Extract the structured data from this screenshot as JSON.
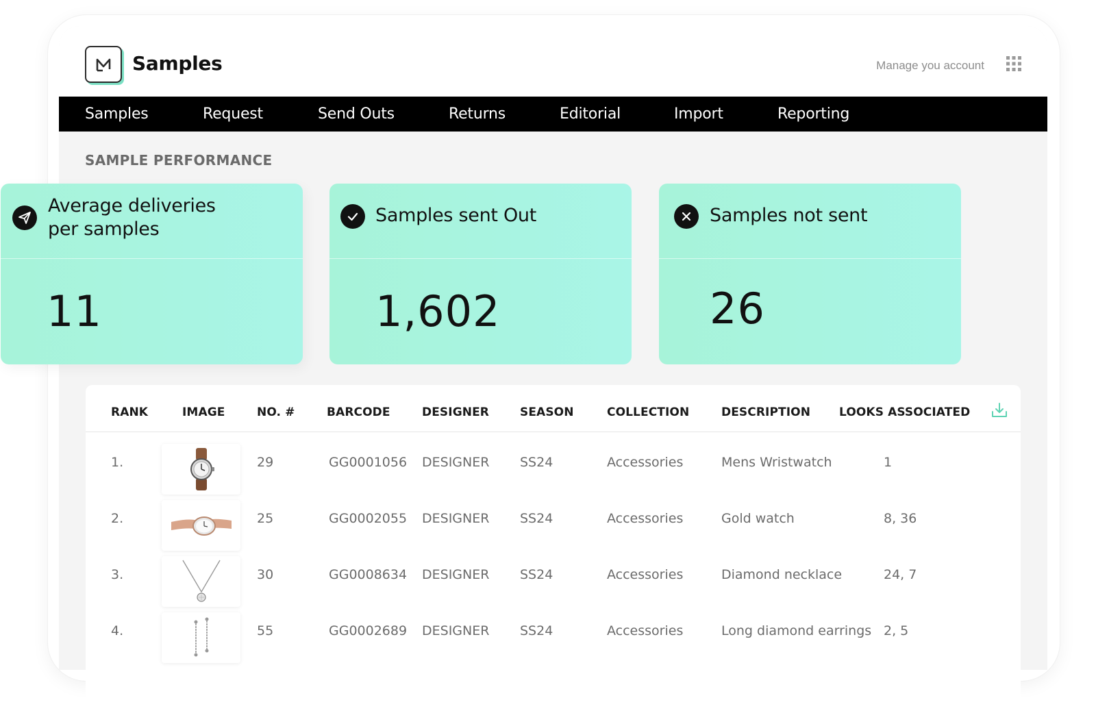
{
  "app": {
    "title": "Samples",
    "manage_account": "Manage you account"
  },
  "nav": [
    {
      "label": "Samples"
    },
    {
      "label": "Request"
    },
    {
      "label": "Send Outs"
    },
    {
      "label": "Returns"
    },
    {
      "label": "Editorial"
    },
    {
      "label": "Import"
    },
    {
      "label": "Reporting"
    }
  ],
  "section": {
    "title": "SAMPLE PERFORMANCE"
  },
  "cards": [
    {
      "label_line1": "Average deliveries",
      "label_line2": "per samples",
      "value": "11",
      "icon": "send-icon"
    },
    {
      "label": "Samples sent Out",
      "value": "1,602",
      "icon": "check-circle-icon"
    },
    {
      "label": "Samples not sent",
      "value": "26",
      "icon": "close-circle-icon"
    }
  ],
  "table": {
    "headers": [
      "RANK",
      "IMAGE",
      "NO. #",
      "BARCODE",
      "DESIGNER",
      "SEASON",
      "COLLECTION",
      "DESCRIPTION",
      "LOOKS ASSOCIATED"
    ],
    "rows": [
      {
        "rank": "1.",
        "image": "watch-leather",
        "no": "29",
        "barcode": "GG0001056",
        "designer": "DESIGNER",
        "season": "SS24",
        "collection": "Accessories",
        "description": "Mens Wristwatch",
        "looks": "1"
      },
      {
        "rank": "2.",
        "image": "watch-gold",
        "no": "25",
        "barcode": "GG0002055",
        "designer": "DESIGNER",
        "season": "SS24",
        "collection": "Accessories",
        "description": "Gold watch",
        "looks": "8, 36"
      },
      {
        "rank": "3.",
        "image": "necklace",
        "no": "30",
        "barcode": "GG0008634",
        "designer": "DESIGNER",
        "season": "SS24",
        "collection": "Accessories",
        "description": "Diamond necklace",
        "looks": "24, 7"
      },
      {
        "rank": "4.",
        "image": "earrings",
        "no": "55",
        "barcode": "GG0002689",
        "designer": "DESIGNER",
        "season": "SS24",
        "collection": "Accessories",
        "description": "Long diamond earrings",
        "looks": "2, 5"
      }
    ]
  },
  "colors": {
    "card_bg": "#a7f3d9",
    "nav_bg": "#000000",
    "accent": "#5fd3b3"
  }
}
